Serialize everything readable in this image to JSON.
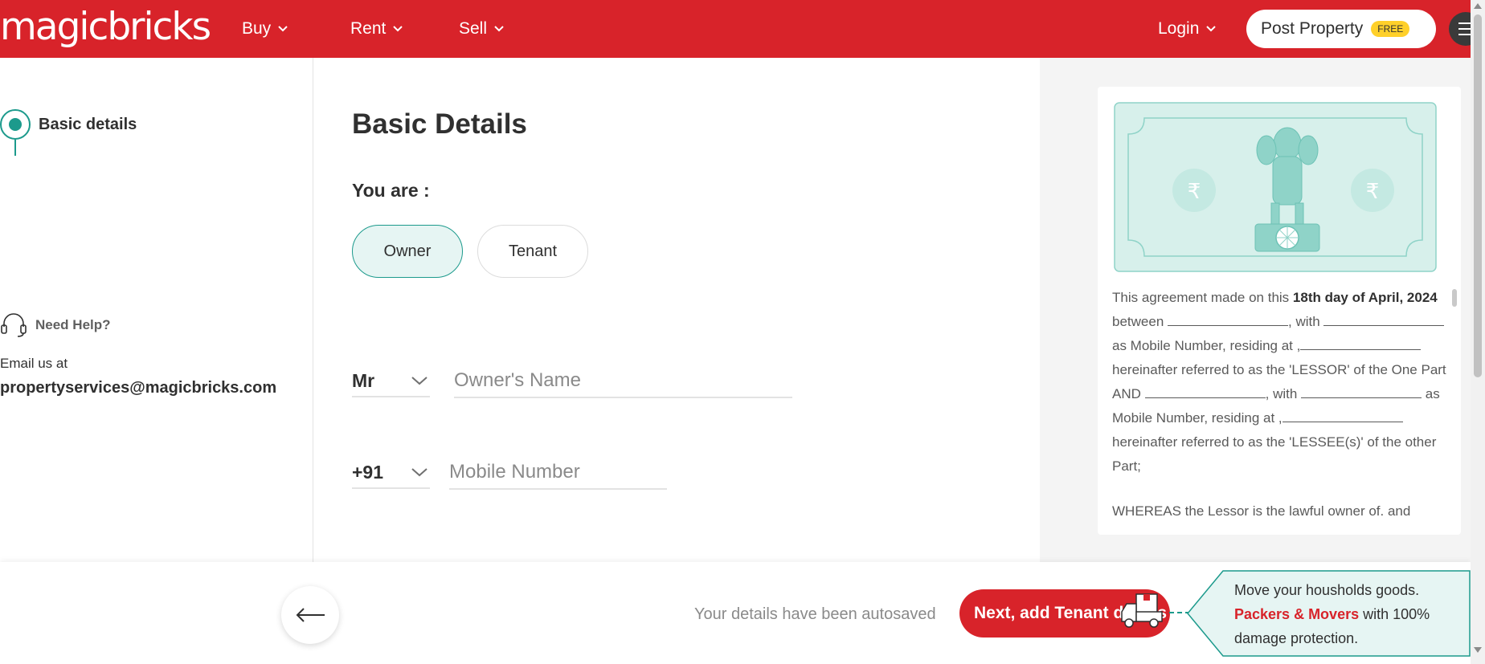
{
  "header": {
    "logo": "magicbricks",
    "nav": [
      {
        "label": "Buy"
      },
      {
        "label": "Rent"
      },
      {
        "label": "Sell"
      }
    ],
    "login": "Login",
    "post_property": "Post Property",
    "free_badge": "FREE",
    "brand_color": "#d8232a"
  },
  "sidebar": {
    "step_label": "Basic details",
    "help_title": "Need Help?",
    "email_label": "Email us at",
    "email": "propertyservices@magicbricks.com"
  },
  "form": {
    "title": "Basic Details",
    "you_are": "You are :",
    "options": [
      "Owner",
      "Tenant"
    ],
    "selected_option": "Owner",
    "salutation": "Mr",
    "name_placeholder": "Owner's Name",
    "country_code": "+91",
    "mobile_placeholder": "Mobile Number",
    "accent_color": "#1c9a8c"
  },
  "preview": {
    "p1_a": "This agreement made on this ",
    "p1_date": "18th day of April, 2024",
    "p1_b": " between ",
    "p1_c": ", with ",
    "p1_d": " as Mobile Number, residing at ,",
    "p1_e": " hereinafter referred to as the 'LESSOR' of the One Part AND ",
    "p1_f": ", with ",
    "p1_g": " as Mobile Number, residing at ,",
    "p1_h": " hereinafter referred to as the 'LESSEE(s)' of the other Part;",
    "p2": "WHEREAS the Lessor is the lawful owner of. and",
    "currency_symbol": "₹"
  },
  "footer": {
    "autosave": "Your details have been autosaved",
    "next_button": "Next, add Tenant details",
    "movers_line1": "Move your housholds goods.",
    "movers_highlight": "Packers & Movers",
    "movers_line2": " with 100% damage protection."
  }
}
